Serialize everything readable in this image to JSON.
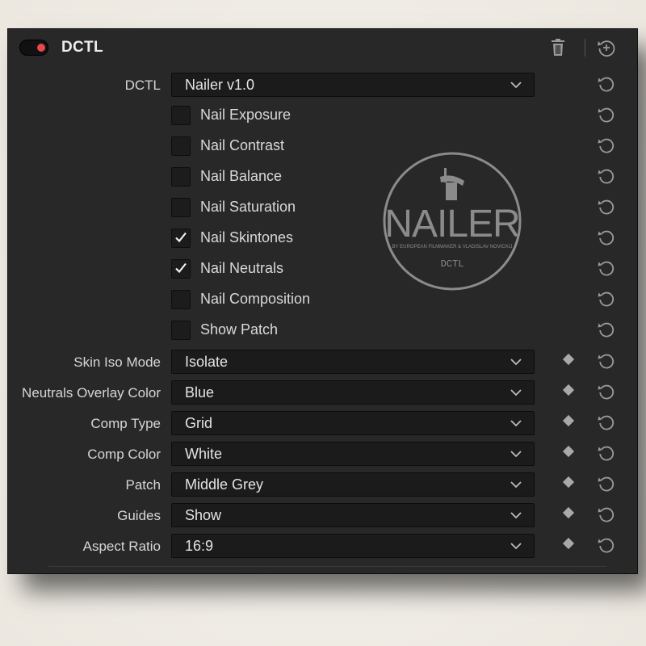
{
  "header": {
    "title": "DCTL"
  },
  "logo": {
    "wordmark": "NAILER",
    "tagline": "BY EUROPEAN FILMMAKER & VLADISLAV NOVICKIJ",
    "sub": "DCTL"
  },
  "dctl_select": {
    "label": "DCTL",
    "value": "Nailer v1.0"
  },
  "checkboxes": [
    {
      "label": "Nail Exposure",
      "checked": false
    },
    {
      "label": "Nail Contrast",
      "checked": false
    },
    {
      "label": "Nail Balance",
      "checked": false
    },
    {
      "label": "Nail Saturation",
      "checked": false
    },
    {
      "label": "Nail Skintones",
      "checked": true
    },
    {
      "label": "Nail Neutrals",
      "checked": true
    },
    {
      "label": "Nail Composition",
      "checked": false
    },
    {
      "label": "Show Patch",
      "checked": false
    }
  ],
  "params": [
    {
      "label": "Skin Iso Mode",
      "value": "Isolate"
    },
    {
      "label": "Neutrals Overlay Color",
      "value": "Blue"
    },
    {
      "label": "Comp Type",
      "value": "Grid"
    },
    {
      "label": "Comp Color",
      "value": "White"
    },
    {
      "label": "Patch",
      "value": "Middle Grey"
    },
    {
      "label": "Guides",
      "value": "Show"
    },
    {
      "label": "Aspect Ratio",
      "value": "16:9"
    }
  ],
  "colors": {
    "panel": "#282828",
    "field": "#1b1b1b",
    "toggle_dot": "#e5484d",
    "text": "#d9d9d9"
  }
}
